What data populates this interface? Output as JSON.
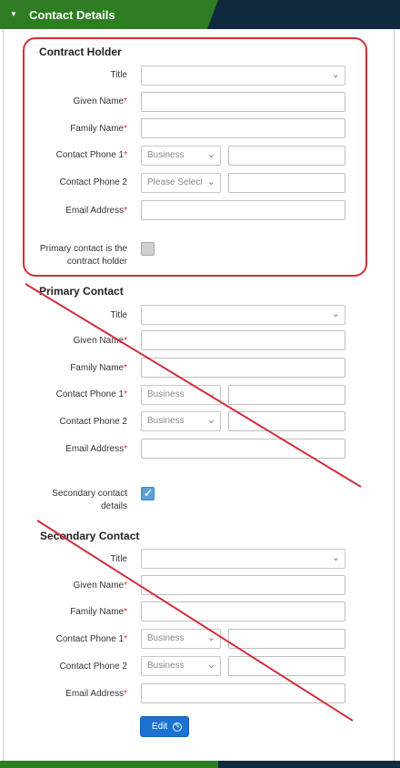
{
  "header": {
    "title": "Contact Details"
  },
  "contract_holder": {
    "title": "Contract Holder",
    "fields": {
      "title": "Title",
      "given_name": "Given Name",
      "family_name": "Family Name",
      "contact_phone_1": "Contact Phone 1",
      "contact_phone_2": "Contact Phone 2",
      "email": "Email Address"
    },
    "phone1_type": "Business",
    "phone2_type": "Please Select",
    "primary_is_holder_label_1": "Primary contact is the",
    "primary_is_holder_label_2": "contract holder"
  },
  "primary_contact": {
    "title": "Primary Contact",
    "fields": {
      "title": "Title",
      "given_name": "Given Name",
      "family_name": "Family Name",
      "contact_phone_1": "Contact Phone 1",
      "contact_phone_2": "Contact Phone 2",
      "email": "Email Address"
    },
    "phone1_type": "Business",
    "phone2_type": "Business",
    "secondary_label_1": "Secondary contact",
    "secondary_label_2": "details"
  },
  "secondary_contact": {
    "title": "Secondary Contact",
    "fields": {
      "title": "Title",
      "given_name": "Given Name",
      "family_name": "Family Name",
      "contact_phone_1": "Contact Phone 1",
      "contact_phone_2": "Contact Phone 2",
      "email": "Email Address"
    },
    "phone1_type": "Business",
    "phone2_type": "Business"
  },
  "edit_button": {
    "label": "Edit"
  },
  "required_mark": "*",
  "colors": {
    "header_green": "#2e7d22",
    "header_navy": "#0f2a3f",
    "annotation_red": "#d12f3a",
    "button_blue": "#1a73d1"
  },
  "icons": {
    "chevron": "chevron-down-icon",
    "edit": "edit-icon",
    "check": "check-icon"
  }
}
